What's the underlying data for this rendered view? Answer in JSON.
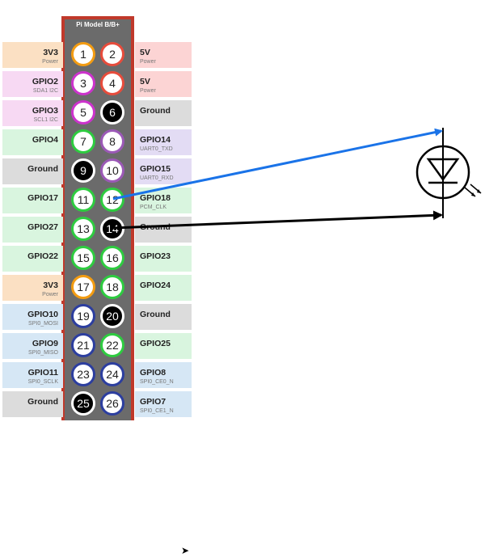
{
  "header": {
    "title": "Pi Model B/B+"
  },
  "colors": {
    "power3v3": "#fbe0c3",
    "power5v": "#fcd4d4",
    "gpio": "#d9f5df",
    "i2c": "#f7d9f3",
    "uart": "#e3dcf4",
    "spi": "#d6e7f5",
    "ground": "#dcdcdc",
    "ring_orange": "#f39c12",
    "ring_red": "#e74c3c",
    "ring_magenta": "#cc33cc",
    "ring_green": "#2ecc40",
    "ring_purple": "#9b59b6",
    "ring_blue": "#2c3e9f",
    "blue_wire": "#1a73e8",
    "black_wire": "#000000"
  },
  "rows": [
    {
      "left": {
        "name": "3V3",
        "sub": "Power",
        "kind": "power3v3"
      },
      "left_pin": {
        "num": "1",
        "ring": "ring_orange"
      },
      "right_pin": {
        "num": "2",
        "ring": "ring_red"
      },
      "right": {
        "name": "5V",
        "sub": "Power",
        "kind": "power5v"
      }
    },
    {
      "left": {
        "name": "GPIO2",
        "sub": "SDA1 I2C",
        "kind": "i2c"
      },
      "left_pin": {
        "num": "3",
        "ring": "ring_magenta"
      },
      "right_pin": {
        "num": "4",
        "ring": "ring_red"
      },
      "right": {
        "name": "5V",
        "sub": "Power",
        "kind": "power5v"
      }
    },
    {
      "left": {
        "name": "GPIO3",
        "sub": "SCL1 I2C",
        "kind": "i2c"
      },
      "left_pin": {
        "num": "5",
        "ring": "ring_magenta"
      },
      "right_pin": {
        "num": "6",
        "ring": "ground"
      },
      "right": {
        "name": "Ground",
        "sub": "",
        "kind": "ground"
      }
    },
    {
      "left": {
        "name": "GPIO4",
        "sub": "",
        "kind": "gpio"
      },
      "left_pin": {
        "num": "7",
        "ring": "ring_green"
      },
      "right_pin": {
        "num": "8",
        "ring": "ring_purple"
      },
      "right": {
        "name": "GPIO14",
        "sub": "UART0_TXD",
        "kind": "uart"
      }
    },
    {
      "left": {
        "name": "Ground",
        "sub": "",
        "kind": "ground"
      },
      "left_pin": {
        "num": "9",
        "ring": "ground"
      },
      "right_pin": {
        "num": "10",
        "ring": "ring_purple"
      },
      "right": {
        "name": "GPIO15",
        "sub": "UART0_RXD",
        "kind": "uart"
      }
    },
    {
      "left": {
        "name": "GPIO17",
        "sub": "",
        "kind": "gpio"
      },
      "left_pin": {
        "num": "11",
        "ring": "ring_green"
      },
      "right_pin": {
        "num": "12",
        "ring": "ring_green"
      },
      "right": {
        "name": "GPIO18",
        "sub": "PCM_CLK",
        "kind": "gpio"
      }
    },
    {
      "left": {
        "name": "GPIO27",
        "sub": "",
        "kind": "gpio"
      },
      "left_pin": {
        "num": "13",
        "ring": "ring_green"
      },
      "right_pin": {
        "num": "14",
        "ring": "ground"
      },
      "right": {
        "name": "Ground",
        "sub": "",
        "kind": "ground"
      }
    },
    {
      "left": {
        "name": "GPIO22",
        "sub": "",
        "kind": "gpio"
      },
      "left_pin": {
        "num": "15",
        "ring": "ring_green"
      },
      "right_pin": {
        "num": "16",
        "ring": "ring_green"
      },
      "right": {
        "name": "GPIO23",
        "sub": "",
        "kind": "gpio"
      }
    },
    {
      "left": {
        "name": "3V3",
        "sub": "Power",
        "kind": "power3v3"
      },
      "left_pin": {
        "num": "17",
        "ring": "ring_orange"
      },
      "right_pin": {
        "num": "18",
        "ring": "ring_green"
      },
      "right": {
        "name": "GPIO24",
        "sub": "",
        "kind": "gpio"
      }
    },
    {
      "left": {
        "name": "GPIO10",
        "sub": "SPI0_MOSI",
        "kind": "spi"
      },
      "left_pin": {
        "num": "19",
        "ring": "ring_blue"
      },
      "right_pin": {
        "num": "20",
        "ring": "ground"
      },
      "right": {
        "name": "Ground",
        "sub": "",
        "kind": "ground"
      }
    },
    {
      "left": {
        "name": "GPIO9",
        "sub": "SPI0_MISO",
        "kind": "spi"
      },
      "left_pin": {
        "num": "21",
        "ring": "ring_blue"
      },
      "right_pin": {
        "num": "22",
        "ring": "ring_green"
      },
      "right": {
        "name": "GPIO25",
        "sub": "",
        "kind": "gpio"
      }
    },
    {
      "left": {
        "name": "GPIO11",
        "sub": "SPI0_SCLK",
        "kind": "spi"
      },
      "left_pin": {
        "num": "23",
        "ring": "ring_blue"
      },
      "right_pin": {
        "num": "24",
        "ring": "ring_blue"
      },
      "right": {
        "name": "GPIO8",
        "sub": "SPI0_CE0_N",
        "kind": "spi"
      }
    },
    {
      "left": {
        "name": "Ground",
        "sub": "",
        "kind": "ground"
      },
      "left_pin": {
        "num": "25",
        "ring": "ground"
      },
      "right_pin": {
        "num": "26",
        "ring": "ring_blue"
      },
      "right": {
        "name": "GPIO7",
        "sub": "SPI0_CE1_N",
        "kind": "spi"
      }
    }
  ],
  "connections": [
    {
      "from_pin": "12",
      "to": "led-anode",
      "color": "blue_wire"
    },
    {
      "from_pin": "14",
      "to": "led-cathode",
      "color": "black_wire"
    }
  ],
  "led": {
    "symbol": "led-icon"
  }
}
